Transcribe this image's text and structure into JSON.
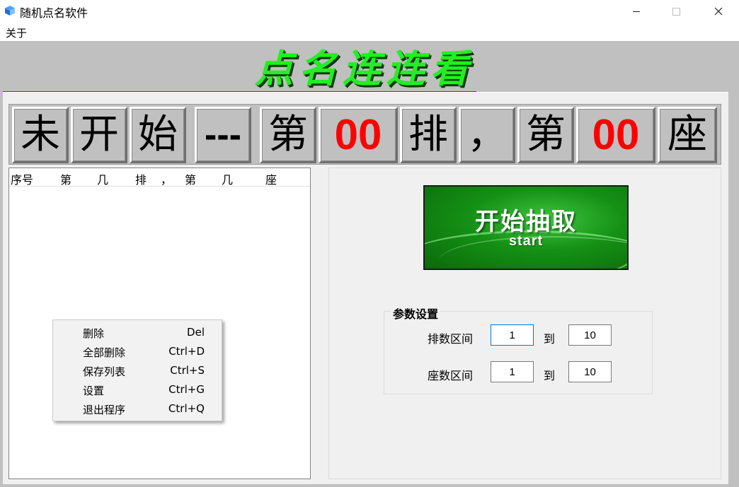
{
  "window": {
    "title": "随机点名软件",
    "icon": "cube-icon",
    "controls": [
      "minimize-icon",
      "maximize-icon",
      "close-icon"
    ]
  },
  "menu": {
    "about": "关于"
  },
  "banner": {
    "title": "点名连连看",
    "title_color": "#22ee22",
    "underline_color": "#1a3fd0"
  },
  "display": {
    "cells": [
      "未",
      "开",
      "始",
      "---",
      "第",
      "00",
      "排",
      "，",
      "第",
      "00",
      "座"
    ],
    "number_color": "#ff0000"
  },
  "list": {
    "headers": [
      "序号",
      "第",
      "几",
      "排",
      "，",
      "第",
      "几",
      "座"
    ]
  },
  "context_menu": {
    "items": [
      {
        "label": "删除",
        "shortcut": "Del"
      },
      {
        "label": "全部删除",
        "shortcut": "Ctrl+D"
      },
      {
        "label": "保存列表",
        "shortcut": "Ctrl+S"
      },
      {
        "label": "设置",
        "shortcut": "Ctrl+G"
      },
      {
        "label": "退出程序",
        "shortcut": "Ctrl+Q"
      }
    ]
  },
  "start_button": {
    "label_cn": "开始抽取",
    "label_en": "start",
    "color": "#159015"
  },
  "params": {
    "legend": "参数设置",
    "to_label": "到",
    "row_range": {
      "label": "排数区间",
      "from": "1",
      "to": "10"
    },
    "seat_range": {
      "label": "座数区间",
      "from": "1",
      "to": "10"
    }
  }
}
